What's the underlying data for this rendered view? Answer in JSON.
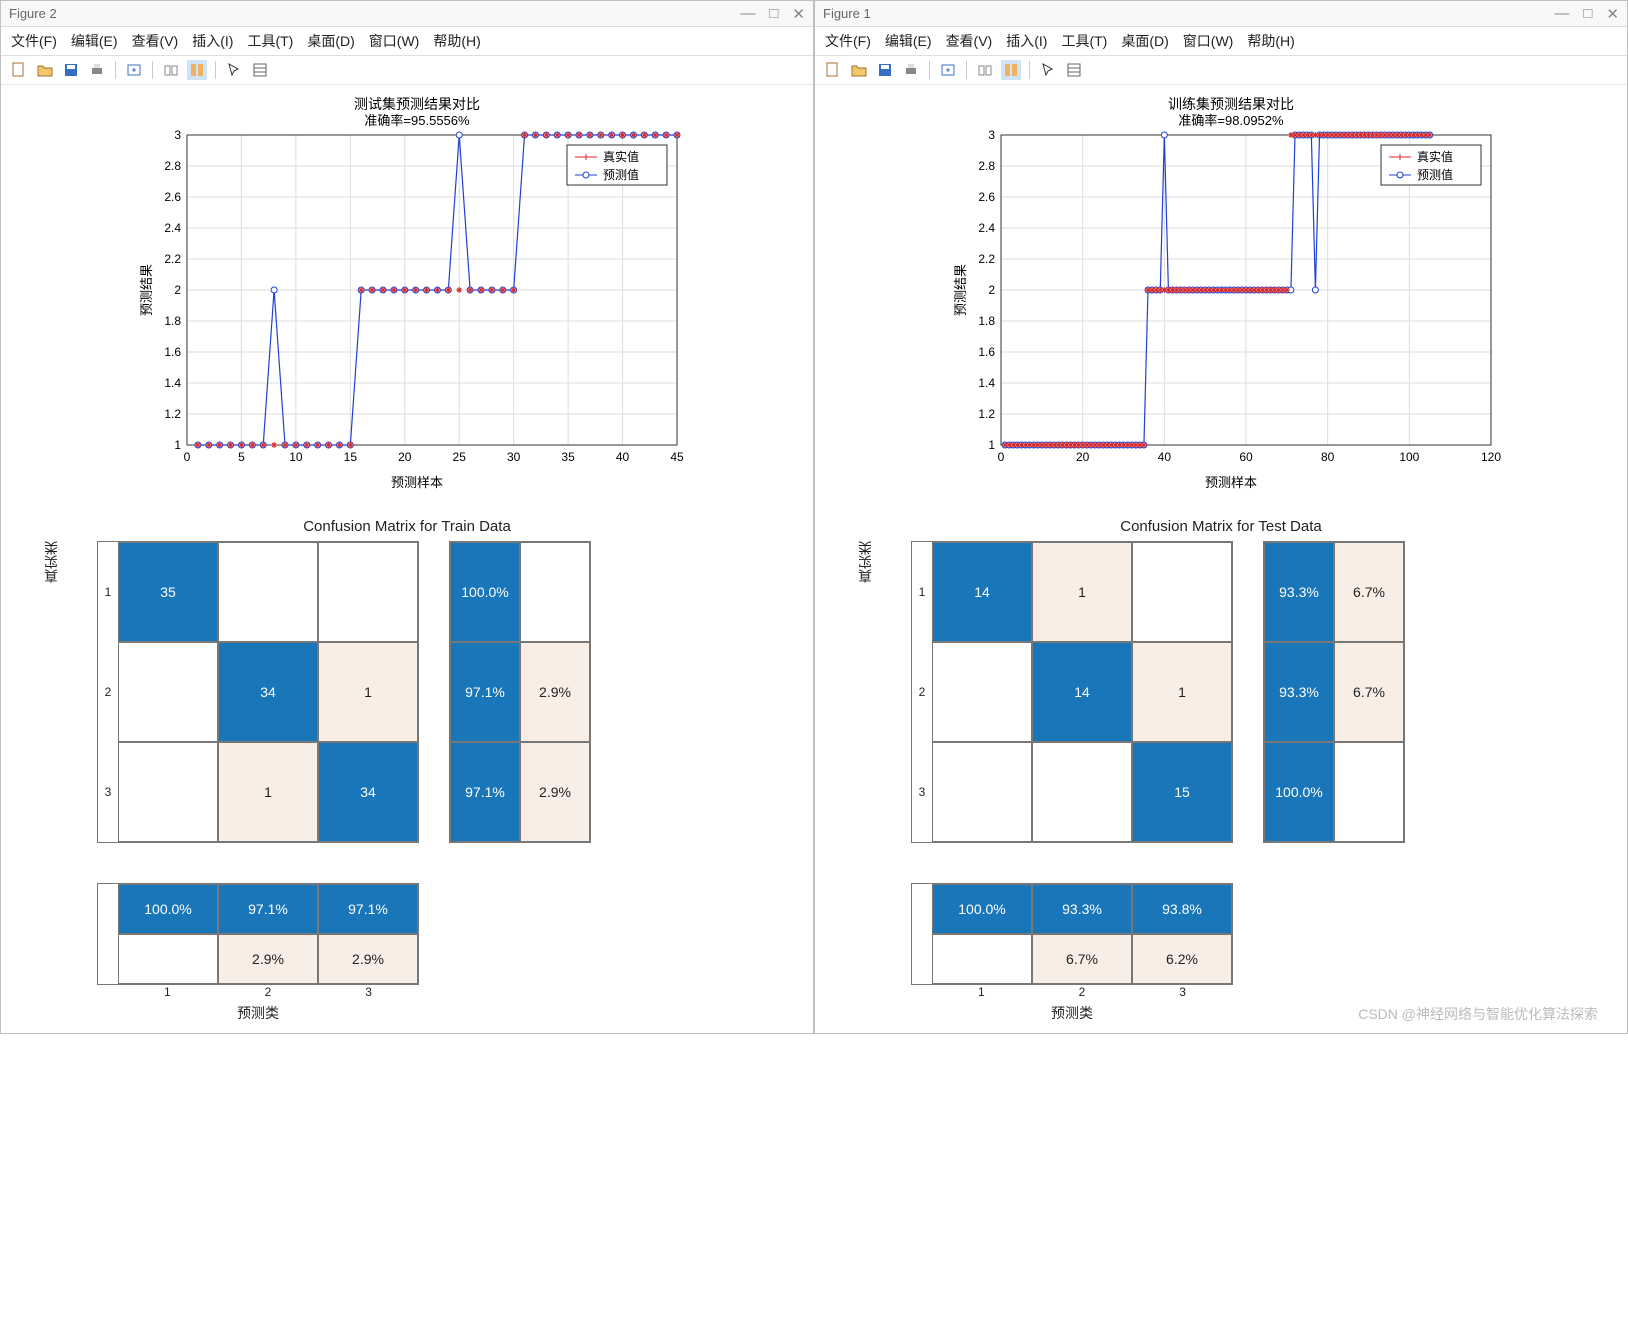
{
  "watermark": "CSDN @神经网络与智能优化算法探索",
  "fig2": {
    "title": "Figure 2",
    "menu": [
      "文件(F)",
      "编辑(E)",
      "查看(V)",
      "插入(I)",
      "工具(T)",
      "桌面(D)",
      "窗口(W)",
      "帮助(H)"
    ],
    "chart": {
      "title": "测试集预测结果对比",
      "subtitle": "准确率=95.5556%"
    },
    "cm_title": "Confusion Matrix for Train Data"
  },
  "fig1": {
    "title": "Figure 1",
    "menu": [
      "文件(F)",
      "编辑(E)",
      "查看(V)",
      "插入(I)",
      "工具(T)",
      "桌面(D)",
      "窗口(W)",
      "帮助(H)"
    ],
    "chart": {
      "title": "训练集预测结果对比",
      "subtitle": "准确率=98.0952%"
    },
    "cm_title": "Confusion Matrix for Test Data"
  },
  "legend": {
    "actual": "真实值",
    "pred": "预测值"
  },
  "axis": {
    "x": "预测样本",
    "y": "预测结果",
    "cm_x": "预测类",
    "cm_y": "真实类"
  },
  "chart_data": [
    {
      "id": "fig2-line",
      "type": "line",
      "title": "测试集预测结果对比",
      "subtitle": "准确率=95.5556%",
      "xlabel": "预测样本",
      "ylabel": "预测结果",
      "xlim": [
        0,
        45
      ],
      "ylim": [
        1,
        3
      ],
      "xticks": [
        0,
        5,
        10,
        15,
        20,
        25,
        30,
        35,
        40,
        45
      ],
      "yticks": [
        1,
        1.2,
        1.4,
        1.6,
        1.8,
        2,
        2.2,
        2.4,
        2.6,
        2.8,
        3
      ],
      "series": [
        {
          "name": "真实值",
          "marker": "star",
          "color": "#d62728",
          "x": [
            1,
            2,
            3,
            4,
            5,
            6,
            7,
            8,
            9,
            10,
            11,
            12,
            13,
            14,
            15,
            16,
            17,
            18,
            19,
            20,
            21,
            22,
            23,
            24,
            25,
            26,
            27,
            28,
            29,
            30,
            31,
            32,
            33,
            34,
            35,
            36,
            37,
            38,
            39,
            40,
            41,
            42,
            43,
            44,
            45
          ],
          "y": [
            1,
            1,
            1,
            1,
            1,
            1,
            1,
            1,
            1,
            1,
            1,
            1,
            1,
            1,
            1,
            2,
            2,
            2,
            2,
            2,
            2,
            2,
            2,
            2,
            2,
            2,
            2,
            2,
            2,
            2,
            3,
            3,
            3,
            3,
            3,
            3,
            3,
            3,
            3,
            3,
            3,
            3,
            3,
            3,
            3
          ]
        },
        {
          "name": "预测值",
          "marker": "circle",
          "color": "#1f3fd6",
          "x": [
            1,
            2,
            3,
            4,
            5,
            6,
            7,
            8,
            9,
            10,
            11,
            12,
            13,
            14,
            15,
            16,
            17,
            18,
            19,
            20,
            21,
            22,
            23,
            24,
            25,
            26,
            27,
            28,
            29,
            30,
            31,
            32,
            33,
            34,
            35,
            36,
            37,
            38,
            39,
            40,
            41,
            42,
            43,
            44,
            45
          ],
          "y": [
            1,
            1,
            1,
            1,
            1,
            1,
            1,
            2,
            1,
            1,
            1,
            1,
            1,
            1,
            1,
            2,
            2,
            2,
            2,
            2,
            2,
            2,
            2,
            2,
            3,
            2,
            2,
            2,
            2,
            2,
            3,
            3,
            3,
            3,
            3,
            3,
            3,
            3,
            3,
            3,
            3,
            3,
            3,
            3,
            3
          ]
        }
      ]
    },
    {
      "id": "fig1-line",
      "type": "line",
      "title": "训练集预测结果对比",
      "subtitle": "准确率=98.0952%",
      "xlabel": "预测样本",
      "ylabel": "预测结果",
      "xlim": [
        0,
        120
      ],
      "ylim": [
        1,
        3
      ],
      "xticks": [
        0,
        20,
        40,
        60,
        80,
        100,
        120
      ],
      "yticks": [
        1,
        1.2,
        1.4,
        1.6,
        1.8,
        2,
        2.2,
        2.4,
        2.6,
        2.8,
        3
      ],
      "series": [
        {
          "name": "真实值",
          "marker": "star",
          "color": "#d62728",
          "x_range": "1-105",
          "y_desc": "1 for 1-35, 2 for 36-70, 3 for 71-105"
        },
        {
          "name": "预测值",
          "marker": "circle",
          "color": "#1f3fd6",
          "x_range": "1-105",
          "y_desc": "same as 真实值 with spikes: ~40→3, ~71→2, ~77→2"
        }
      ]
    },
    {
      "id": "fig2-cm",
      "type": "table",
      "title": "Confusion Matrix for Train Data",
      "xlabel": "预测类",
      "ylabel": "真实类",
      "classes": [
        "1",
        "2",
        "3"
      ],
      "matrix": [
        [
          35,
          0,
          0
        ],
        [
          0,
          34,
          1
        ],
        [
          0,
          1,
          34
        ]
      ],
      "row_percent": [
        [
          "100.0%",
          ""
        ],
        [
          "97.1%",
          "2.9%"
        ],
        [
          "97.1%",
          "2.9%"
        ]
      ],
      "col_percent_top": [
        "100.0%",
        "97.1%",
        "97.1%"
      ],
      "col_percent_bot": [
        "",
        "2.9%",
        "2.9%"
      ]
    },
    {
      "id": "fig1-cm",
      "type": "table",
      "title": "Confusion Matrix for Test Data",
      "xlabel": "预测类",
      "ylabel": "真实类",
      "classes": [
        "1",
        "2",
        "3"
      ],
      "matrix": [
        [
          14,
          1,
          0
        ],
        [
          0,
          14,
          1
        ],
        [
          0,
          0,
          15
        ]
      ],
      "row_percent": [
        [
          "93.3%",
          "6.7%"
        ],
        [
          "93.3%",
          "6.7%"
        ],
        [
          "100.0%",
          ""
        ]
      ],
      "col_percent_top": [
        "100.0%",
        "93.3%",
        "93.8%"
      ],
      "col_percent_bot": [
        "",
        "6.7%",
        "6.2%"
      ]
    }
  ]
}
